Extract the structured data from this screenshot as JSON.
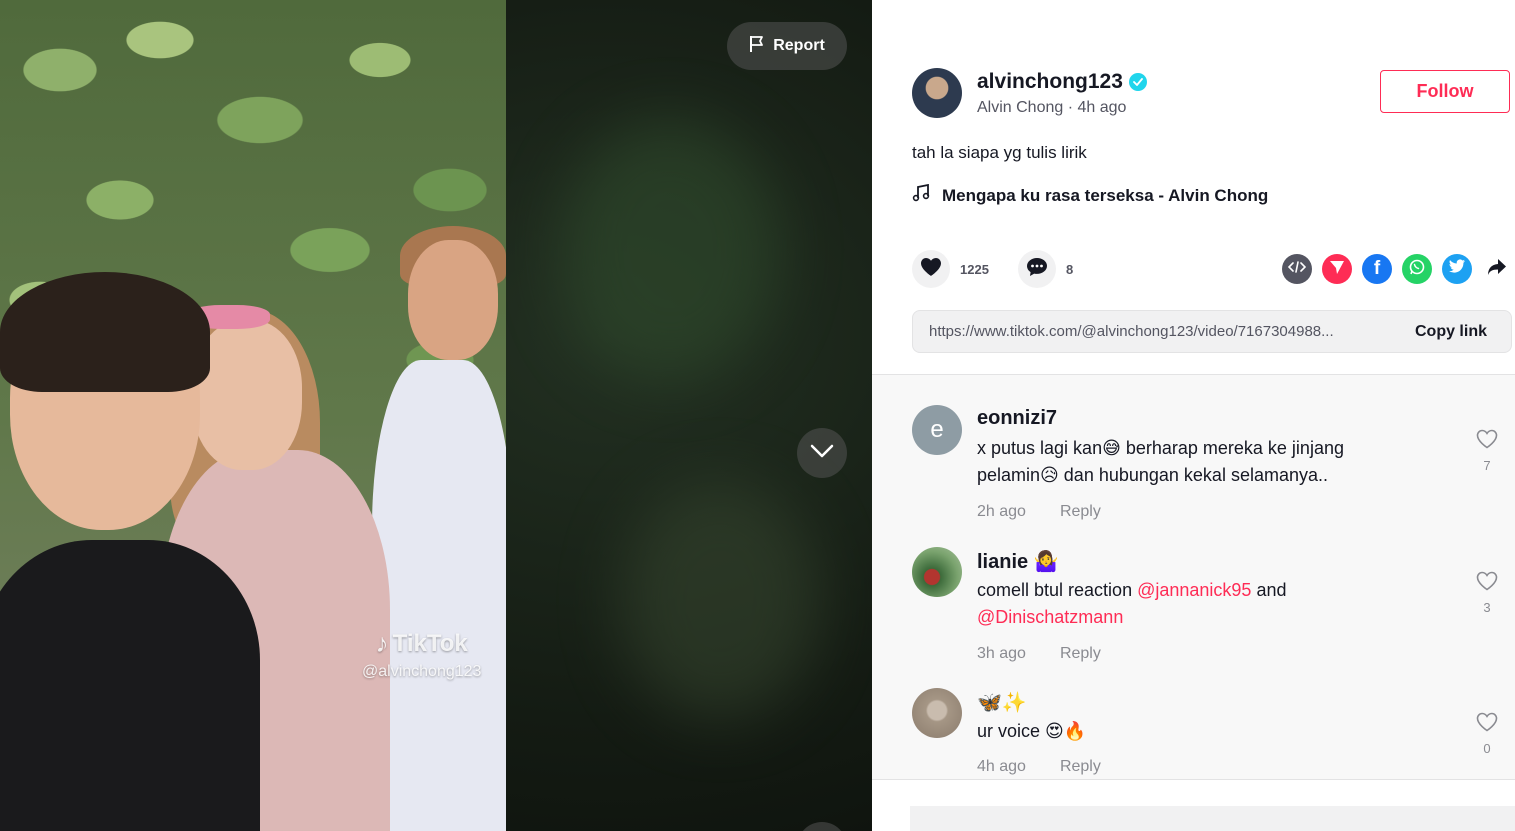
{
  "video": {
    "report_label": "Report",
    "watermark_brand": "TikTok",
    "watermark_handle": "@alvinchong123"
  },
  "author": {
    "username": "alvinchong123",
    "display_name": "Alvin Chong",
    "time_ago": "4h ago",
    "separator": " · ",
    "follow_label": "Follow"
  },
  "post": {
    "caption": "tah la siapa yg tulis lirik",
    "music": "Mengapa ku rasa terseksa - Alvin Chong",
    "likes": "1225",
    "comments_count": "8",
    "link": "https://www.tiktok.com/@alvinchong123/video/7167304988...",
    "copy_link_label": "Copy link"
  },
  "share_icons": [
    "embed-icon",
    "send-icon",
    "facebook-icon",
    "whatsapp-icon",
    "twitter-icon",
    "share-arrow-icon"
  ],
  "colors": {
    "accent": "#fe2c55",
    "verified": "#20d5ec",
    "facebook": "#1877f2",
    "whatsapp": "#25d366",
    "twitter": "#1da1f2",
    "embed": "#545561"
  },
  "comments": [
    {
      "avatar_letter": "e",
      "username": "eonnizi7",
      "text_part1": "x putus lagi kan😅 berharap mereka ke jinjang",
      "text_part2": "pelamin😥 dan hubungan kekal selamanya..",
      "time": "2h ago",
      "reply_label": "Reply",
      "likes": "7"
    },
    {
      "username": "lianie 🤷‍♀️",
      "text_part1": "comell btul reaction ",
      "mention1": "@jannanick95",
      "text_part2": " and",
      "mention2": "@Dinischatzmann",
      "time": "3h ago",
      "reply_label": "Reply",
      "likes": "3"
    },
    {
      "username": "🦋✨",
      "text": "ur voice 😍🔥",
      "time": "4h ago",
      "reply_label": "Reply",
      "likes": "0"
    }
  ]
}
